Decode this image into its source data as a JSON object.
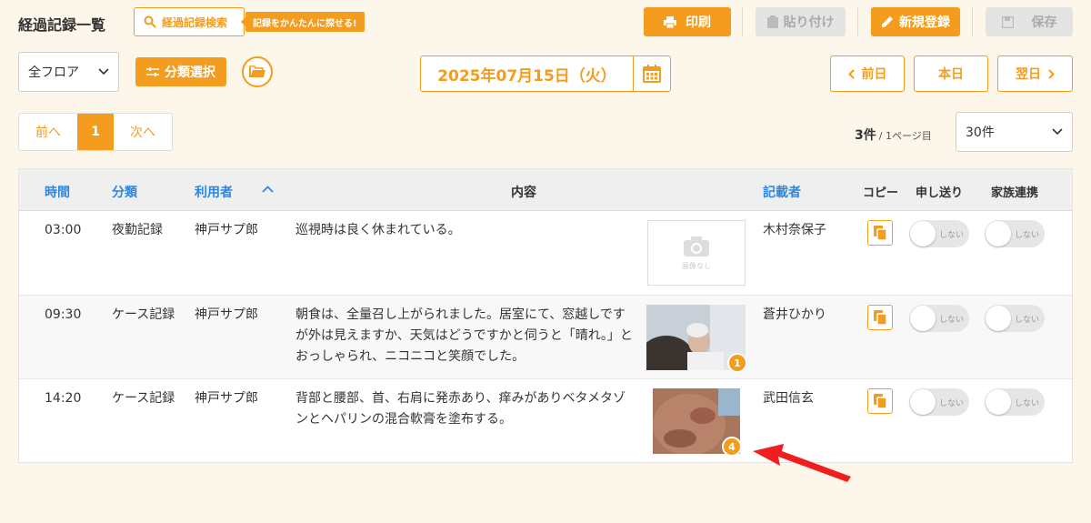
{
  "header": {
    "title": "経過記録一覧",
    "search_label": "経過記録検索",
    "search_tip": "記録をかんたんに探せる!",
    "print_label": "印刷",
    "paste_label": "貼り付け",
    "new_label": "新規登録",
    "save_label": "保存"
  },
  "filters": {
    "floor": "全フロア",
    "category_label": "分類選択",
    "date": "2025年07月15日（火）",
    "prev_day": "前日",
    "today": "本日",
    "next_day": "翌日"
  },
  "pagination": {
    "prev": "前へ",
    "current": "1",
    "next": "次へ",
    "count": "3件",
    "page_info": "/ 1ページ目",
    "per_page": "30件"
  },
  "table": {
    "headers": {
      "time": "時間",
      "category": "分類",
      "user": "利用者",
      "content": "内容",
      "author": "記載者",
      "copy": "コピー",
      "handover": "申し送り",
      "family": "家族連携"
    },
    "no_image": "画像なし",
    "toggle_off": "しない",
    "rows": [
      {
        "time": "03:00",
        "category": "夜勤記録",
        "user": "神戸サプ郎",
        "content": "巡視時は良く休まれている。",
        "author": "木村奈保子",
        "photo_count": ""
      },
      {
        "time": "09:30",
        "category": "ケース記録",
        "user": "神戸サプ郎",
        "content": "朝食は、全量召し上がられました。居室にて、窓越しですが外は見えますか、天気はどうですかと伺うと「晴れ。」とおっしゃられ、ニコニコと笑顔でした。",
        "author": "蒼井ひかり",
        "photo_count": "1"
      },
      {
        "time": "14:20",
        "category": "ケース記録",
        "user": "神戸サプ郎",
        "content": "背部と腰部、首、右肩に発赤あり、痒みがありベタメタゾンとヘパリンの混合軟膏を塗布する。",
        "author": "武田信玄",
        "photo_count": "4"
      }
    ]
  },
  "colors": {
    "accent": "#f39c1e",
    "link": "#2e86de",
    "background": "#fdf6ea",
    "annotation_arrow": "#f01e1e"
  }
}
